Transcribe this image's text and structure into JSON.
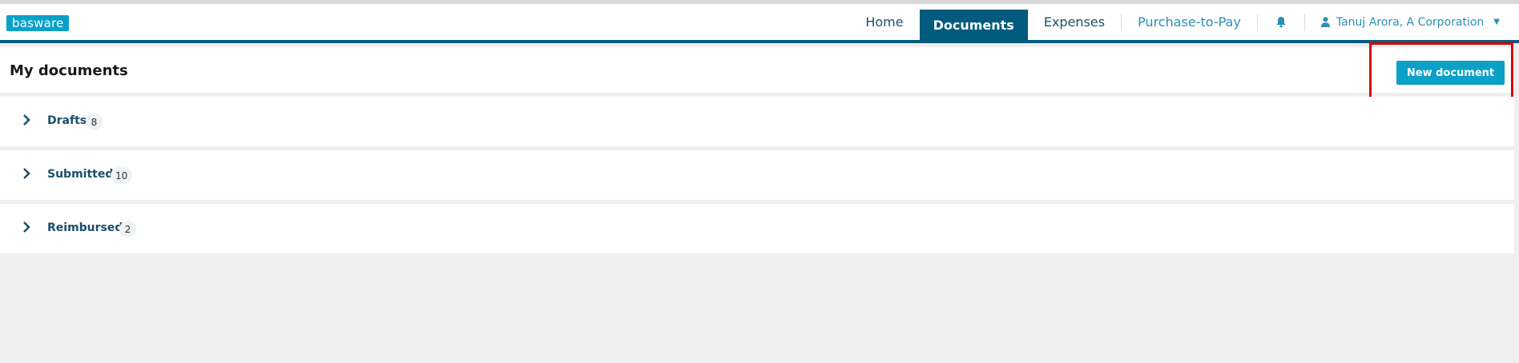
{
  "app": {
    "logo_text": "basware"
  },
  "nav": {
    "items": [
      {
        "label": "Home"
      },
      {
        "label": "Documents"
      },
      {
        "label": "Expenses"
      },
      {
        "label": "Purchase-to-Pay"
      }
    ],
    "active_item": "Documents",
    "notifications_icon": "bell-icon",
    "user": {
      "name": "Tanuj Arora, A Corporation",
      "icon": "person-icon"
    }
  },
  "page": {
    "title": "My documents",
    "new_document_label": "New document"
  },
  "sections": [
    {
      "label": "Drafts",
      "count": "8"
    },
    {
      "label": "Submitted",
      "count": "10"
    },
    {
      "label": "Reimbursed",
      "count": "2"
    }
  ],
  "colors": {
    "brand": "#0aa0c8",
    "nav_active": "#005b7f",
    "highlight": "#e00000",
    "background": "#efefef"
  }
}
